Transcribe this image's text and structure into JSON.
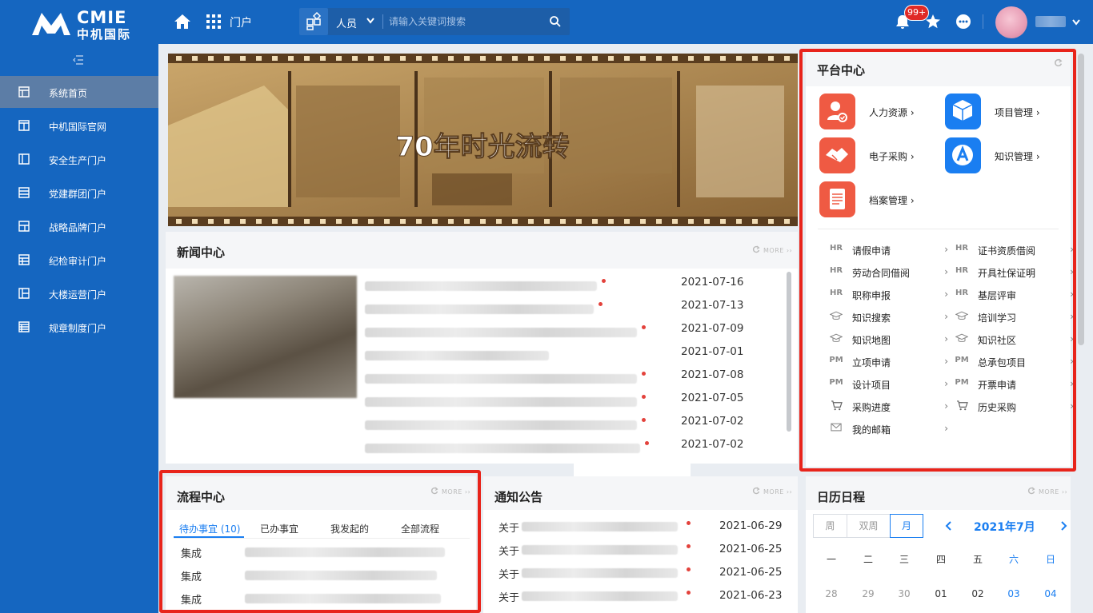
{
  "header": {
    "logo_en": "CMIE",
    "logo_cn": "中机国际",
    "portal_label": "门户",
    "search": {
      "category": "人员",
      "placeholder": "请输入关键词搜索"
    },
    "notification_badge": "99+"
  },
  "sidebar": {
    "items": [
      {
        "label": "系统首页",
        "active": true
      },
      {
        "label": "中机国际官网"
      },
      {
        "label": "安全生产门户"
      },
      {
        "label": "党建群团门户"
      },
      {
        "label": "战略品牌门户"
      },
      {
        "label": "纪检审计门户"
      },
      {
        "label": "大楼运营门户"
      },
      {
        "label": "规章制度门户"
      }
    ]
  },
  "banner": {
    "title": "70年时光流转"
  },
  "news": {
    "title": "新闻中心",
    "more": "MORE",
    "dates": [
      "2021-07-16",
      "2021-07-13",
      "2021-07-09",
      "2021-07-01",
      "2021-07-08",
      "2021-07-05",
      "2021-07-02",
      "2021-07-02"
    ]
  },
  "platform": {
    "title": "平台中心",
    "apps": [
      {
        "label": "人力资源 ›",
        "color": "#ef5a43"
      },
      {
        "label": "项目管理 ›",
        "color": "#1a7ef1"
      },
      {
        "label": "电子采购 ›",
        "color": "#ef5a43"
      },
      {
        "label": "知识管理 ›",
        "color": "#1a7ef1"
      },
      {
        "label": "档案管理 ›",
        "color": "#ef5a43"
      }
    ],
    "links": [
      {
        "icon": "HR",
        "label": "请假申请"
      },
      {
        "icon": "HR",
        "label": "证书资质借阅"
      },
      {
        "icon": "HR",
        "label": "劳动合同借阅"
      },
      {
        "icon": "HR",
        "label": "开具社保证明"
      },
      {
        "icon": "HR",
        "label": "职称申报"
      },
      {
        "icon": "HR",
        "label": "基层评审"
      },
      {
        "icon": "graduation-cap-icon",
        "label": "知识搜索"
      },
      {
        "icon": "graduation-cap-icon",
        "label": "培训学习"
      },
      {
        "icon": "graduation-cap-icon",
        "label": "知识地图"
      },
      {
        "icon": "graduation-cap-icon",
        "label": "知识社区"
      },
      {
        "icon": "PM",
        "label": "立项申请"
      },
      {
        "icon": "PM",
        "label": "总承包项目"
      },
      {
        "icon": "PM",
        "label": "设计项目"
      },
      {
        "icon": "PM",
        "label": "开票申请"
      },
      {
        "icon": "cart-icon",
        "label": "采购进度"
      },
      {
        "icon": "cart-icon",
        "label": "历史采购"
      },
      {
        "icon": "mail-icon",
        "label": "我的邮箱"
      }
    ],
    "arrow": "›"
  },
  "flow": {
    "title": "流程中心",
    "more": "MORE",
    "tabs": [
      "待办事宜 (10)",
      "已办事宜",
      "我发起的",
      "全部流程"
    ],
    "rows": [
      "集成",
      "集成",
      "集成"
    ]
  },
  "notice": {
    "title": "通知公告",
    "more": "MORE",
    "items": [
      {
        "prefix": "关于",
        "date": "2021-06-29"
      },
      {
        "prefix": "关于",
        "date": "2021-06-25"
      },
      {
        "prefix": "关于",
        "date": "2021-06-25"
      },
      {
        "prefix": "关于",
        "date": "2021-06-23"
      }
    ]
  },
  "calendar": {
    "title": "日历日程",
    "more": "MORE",
    "views": [
      "周",
      "双周",
      "月"
    ],
    "active_view": "月",
    "month": "2021年7月",
    "weekdays": [
      "一",
      "二",
      "三",
      "四",
      "五",
      "六",
      "日"
    ],
    "first_row": [
      "28",
      "29",
      "30",
      "01",
      "02",
      "03",
      "04"
    ]
  }
}
